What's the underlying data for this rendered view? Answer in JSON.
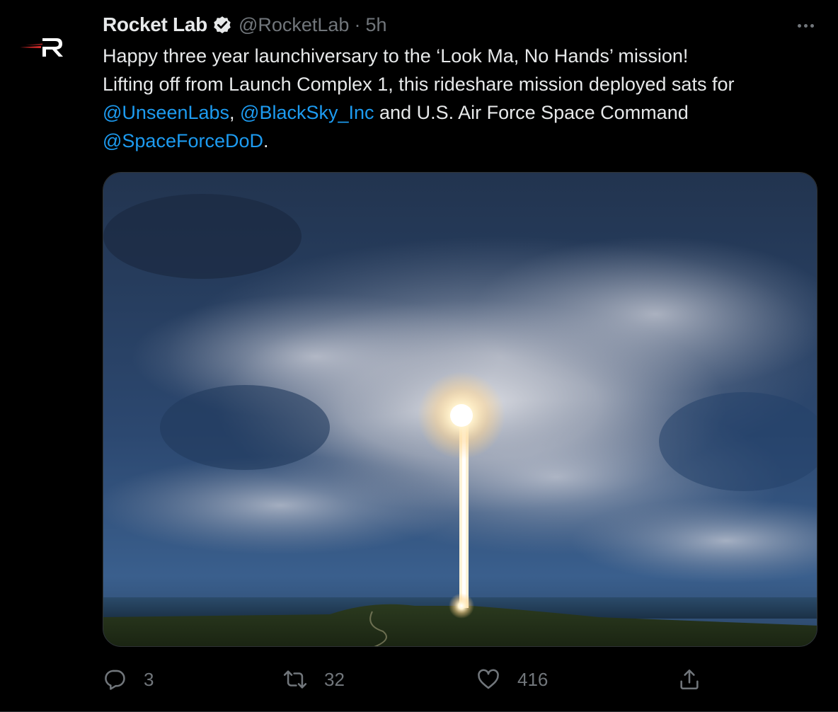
{
  "author": {
    "display_name": "Rocket Lab",
    "handle": "@RocketLab",
    "separator": "·",
    "timestamp": "5h",
    "verified": true
  },
  "tweet": {
    "line1": "Happy three year launchiversary to the ‘Look Ma, No Hands’ mission!",
    "line2": "Lifting off from Launch Complex 1, this rideshare mission deployed sats for",
    "mention1": "@UnseenLabs",
    "sep1": ", ",
    "mention2": "@BlackSky_Inc",
    "line3_rest": " and U.S. Air Force Space Command",
    "mention3": "@SpaceForceDoD",
    "end": "."
  },
  "actions": {
    "reply_count": "3",
    "retweet_count": "32",
    "like_count": "416"
  },
  "icons": {
    "avatar": "rocket-lab-logo",
    "verified": "verified-badge-icon",
    "more": "more-options-icon",
    "reply": "reply-icon",
    "retweet": "retweet-icon",
    "like": "heart-icon",
    "share": "share-icon"
  },
  "colors": {
    "background": "#000000",
    "text": "#e7e9ea",
    "secondary": "#71767b",
    "link": "#1d9bf0",
    "brand_red": "#d62b2b"
  }
}
